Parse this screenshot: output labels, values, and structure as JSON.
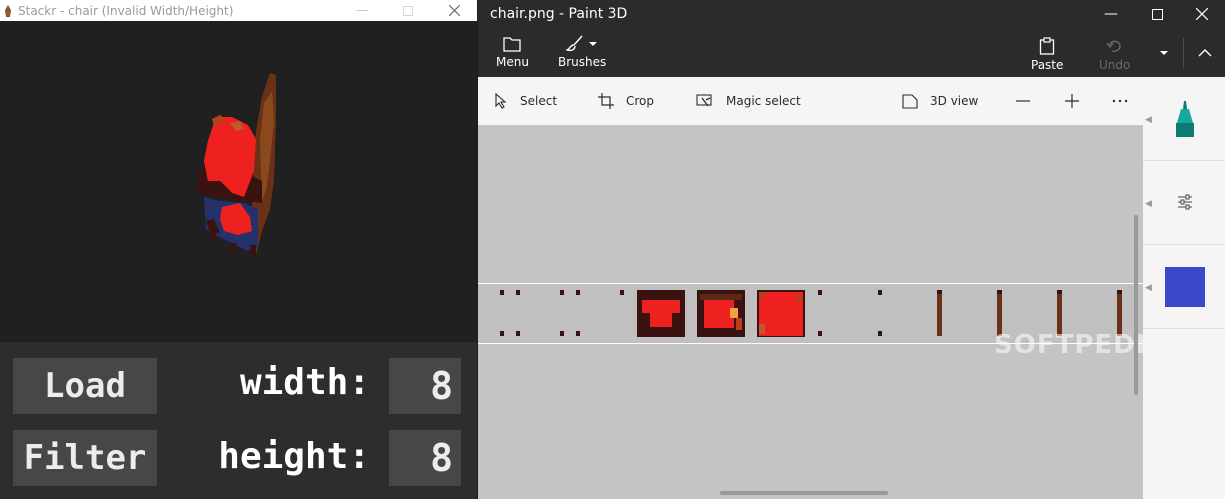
{
  "stackr": {
    "title": "Stackr - chair (Invalid Width/Height)",
    "load_label": "Load",
    "filter_label": "Filter",
    "width_label": "width:",
    "height_label": "height:",
    "width_value": "8",
    "height_value": "8"
  },
  "paint": {
    "title": "chair.png - Paint 3D",
    "menu_label": "Menu",
    "brushes_label": "Brushes",
    "paste_label": "Paste",
    "undo_label": "Undo",
    "toolbar": {
      "select": "Select",
      "crop": "Crop",
      "magic_select": "Magic select",
      "view_3d": "3D view"
    },
    "watermark": "SOFTPEDIA",
    "current_color": "#3a48c8"
  },
  "colors": {
    "chair_red": "#ef2020",
    "chair_wood": "#6b3116",
    "chair_dark": "#3a1210",
    "chair_blue": "#25316a"
  }
}
